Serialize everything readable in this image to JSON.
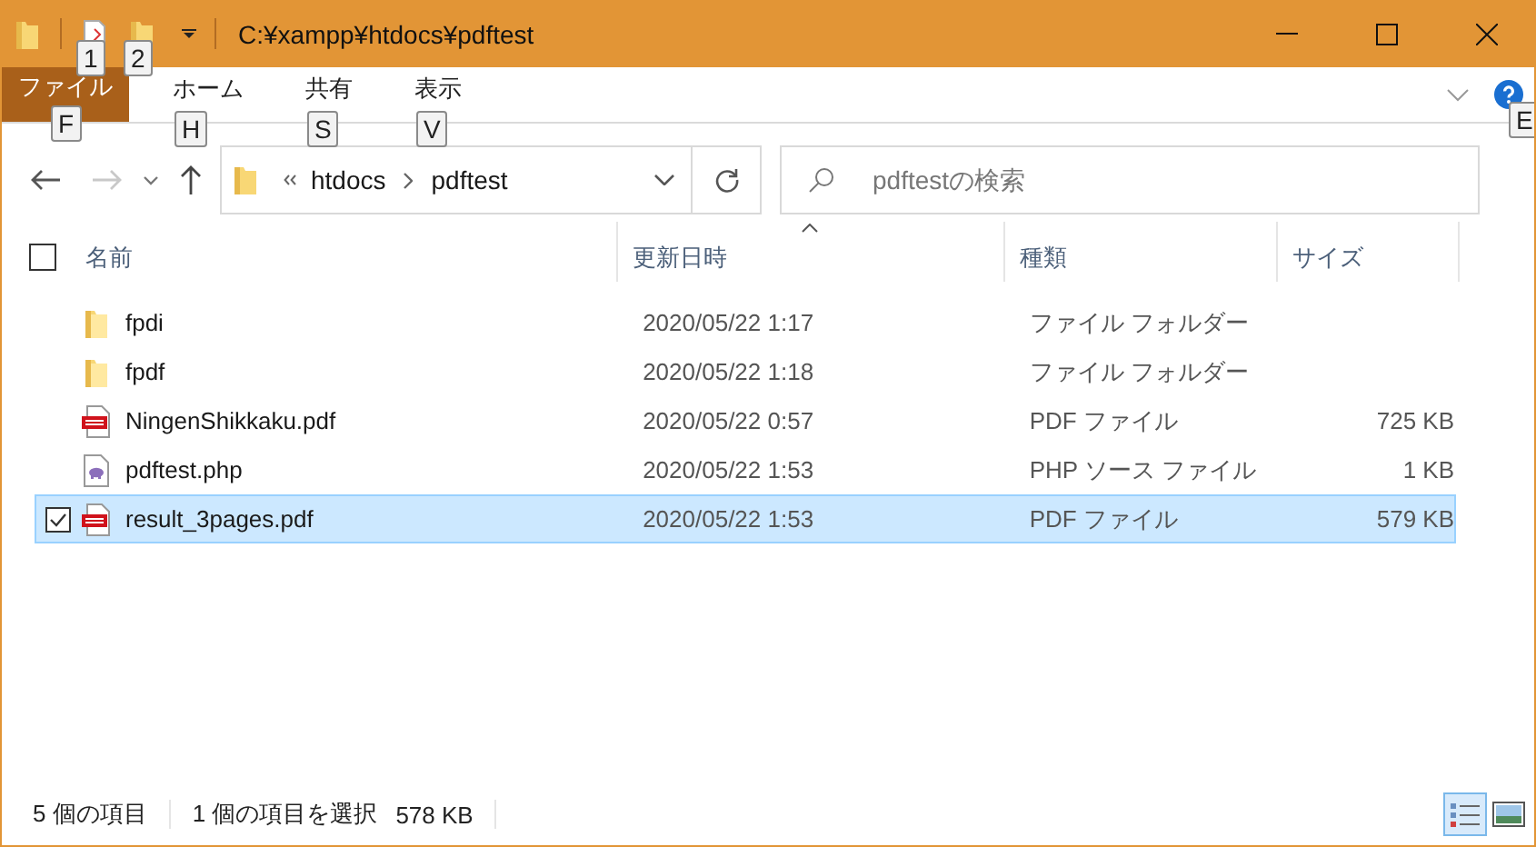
{
  "window": {
    "title": "C:¥xampp¥htdocs¥pdftest"
  },
  "quick_access_keytips": [
    "1",
    "2"
  ],
  "ribbon_tabs": [
    {
      "label": "ファイル",
      "kind": "file",
      "keytip": "F"
    },
    {
      "label": "ホーム",
      "kind": "tab",
      "keytip": "H"
    },
    {
      "label": "共有",
      "kind": "tab",
      "keytip": "S"
    },
    {
      "label": "表示",
      "kind": "tab",
      "keytip": "V"
    }
  ],
  "help_keytip": "E",
  "breadcrumb": [
    "htdocs",
    "pdftest"
  ],
  "search": {
    "placeholder": "pdftestの検索"
  },
  "select_all": {
    "checked": false
  },
  "columns": [
    {
      "label": "名前",
      "sorted": false
    },
    {
      "label": "更新日時",
      "sorted": true
    },
    {
      "label": "種類",
      "sorted": false
    },
    {
      "label": "サイズ",
      "sorted": false
    }
  ],
  "files": [
    {
      "name": "fpdi",
      "kind": "folder",
      "modified": "2020/05/22 1:17",
      "type": "ファイル フォルダー",
      "selected": false
    },
    {
      "name": "fpdf",
      "kind": "folder",
      "modified": "2020/05/22 1:18",
      "type": "ファイル フォルダー",
      "selected": false
    },
    {
      "name": "NingenShikkaku.pdf",
      "kind": "pdf",
      "modified": "2020/05/22 0:57",
      "type": "PDF ファイル",
      "size": "725 KB",
      "selected": false
    },
    {
      "name": "pdftest.php",
      "kind": "php",
      "modified": "2020/05/22 1:53",
      "type": "PHP ソース ファイル",
      "size": "1 KB",
      "selected": false
    },
    {
      "name": "result_3pages.pdf",
      "kind": "pdf",
      "modified": "2020/05/22 1:53",
      "type": "PDF ファイル",
      "size": "579 KB",
      "selected": true
    }
  ],
  "status_bar": {
    "item_count": "5 個の項目",
    "selection": "1 個の項目を選択",
    "selection_size": "578 KB"
  },
  "view_modes": [
    {
      "kind": "details",
      "selected": true
    },
    {
      "kind": "tiles",
      "selected": false
    }
  ]
}
